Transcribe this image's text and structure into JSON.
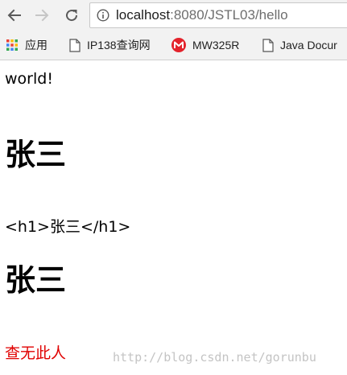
{
  "browser": {
    "url_host": "localhost",
    "url_rest": ":8080/JSTL03/hello"
  },
  "bookmarks": [
    {
      "label": "应用",
      "icon": "apps-grid-icon"
    },
    {
      "label": "IP138查询网",
      "icon": "page-icon"
    },
    {
      "label": "MW325R",
      "icon": "mercury-logo-icon"
    },
    {
      "label": "Java Docur",
      "icon": "page-icon"
    }
  ],
  "page": {
    "world": "world!",
    "heading_first": "张三",
    "raw_markup": "<h1>张三</h1>",
    "heading_second": "张三",
    "not_found": "查无此人"
  },
  "watermark": "http://blog.csdn.net/gorunbu",
  "colors": {
    "not_found_text": "#e00000",
    "toolbar_bg": "#f2f2f2",
    "mercury_logo": "#e3222b"
  }
}
